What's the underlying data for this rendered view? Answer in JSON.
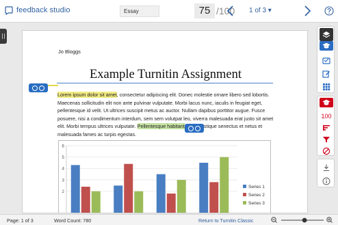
{
  "topbar": {
    "brand": "feedback studio",
    "brand_icon": "turnitin-logo-icon",
    "assignment_chip": "Essay",
    "score": "75",
    "score_total": "/100",
    "page_selector": "1 of 3 ▾",
    "prev_icon": "chevron-left-icon",
    "next_icon": "chevron-right-icon",
    "help_icon": "help-icon"
  },
  "document": {
    "author": "Jo Bloggs",
    "title": "Example Turnitin Assignment",
    "para_hl1": "Lorem ipsum dolor sit amet",
    "para_t1": ", consectetur adipiscing elit. Donec molestie ornare libero sed lobortis. Maecenas sollicitudin elit non ante pulvinar vulputate. Morbi lacus nunc, iaculis in feugiat eget, pellentesque id velit. Ut ultrices suscipit metus ac auctor. Nullam dapibus porttitor augue. Fusce posuere, nisi a condimentum interdum, sem sem volutpat leo, viverra malesuada erat justo sit amet elit. Morbi tempus ultrices vulputate. ",
    "para_hl2": "Pellentesque habitant",
    "para_t2": " morbi tristique senectus et netus et malesuada fames ac turpis egestas.",
    "comment_icon": "comment-bubble-icon"
  },
  "chart_data": {
    "type": "bar",
    "categories": [
      "",
      "",
      "",
      ""
    ],
    "series": [
      {
        "name": "Series 1",
        "values": [
          4.3,
          2.5,
          3.5,
          4.5
        ]
      },
      {
        "name": "Series 2",
        "values": [
          2.4,
          4.4,
          1.8,
          2.8
        ]
      },
      {
        "name": "Series 3",
        "values": [
          2,
          2,
          3,
          5
        ]
      }
    ],
    "y_ticks": [
      "6",
      "5",
      "4",
      "3",
      "2"
    ],
    "ylim": [
      0,
      6
    ],
    "grid": true,
    "legend_position": "right",
    "colors": [
      "#4a7ec2",
      "#c0504d",
      "#9bbb59"
    ]
  },
  "rail": {
    "top_tools": [
      {
        "name": "layers-icon",
        "kind": "dark"
      },
      {
        "name": "grading-cap-icon",
        "kind": "cap-blue"
      },
      {
        "name": "quickmark-icon",
        "kind": "blue"
      },
      {
        "name": "edit-icon",
        "kind": "blue"
      },
      {
        "name": "rubric-grid-icon",
        "kind": "blue"
      }
    ],
    "similarity_tools": [
      {
        "name": "similarity-cap-icon",
        "kind": "cap-red"
      },
      {
        "name": "similarity-score",
        "kind": "num"
      },
      {
        "name": "match-list-icon",
        "kind": "red"
      },
      {
        "name": "filter-icon",
        "kind": "red"
      },
      {
        "name": "exclude-icon",
        "kind": "red"
      }
    ],
    "similarity_value": "100",
    "bottom_tools": [
      {
        "name": "download-icon"
      },
      {
        "name": "info-icon"
      }
    ]
  },
  "statusbar": {
    "page": "Page: 1 of 3",
    "words": "Word Count: 780",
    "return_link": "Return to Turnitin Classic",
    "zoom_out_icon": "zoom-out-icon",
    "zoom_in_icon": "zoom-in-icon",
    "zoom_level": 0.55
  },
  "colors": {
    "accent": "#2e5f9e",
    "similarity": "#d0021b",
    "highlight_yellow": "#f1ea82",
    "highlight_green": "#c6e3a3"
  }
}
